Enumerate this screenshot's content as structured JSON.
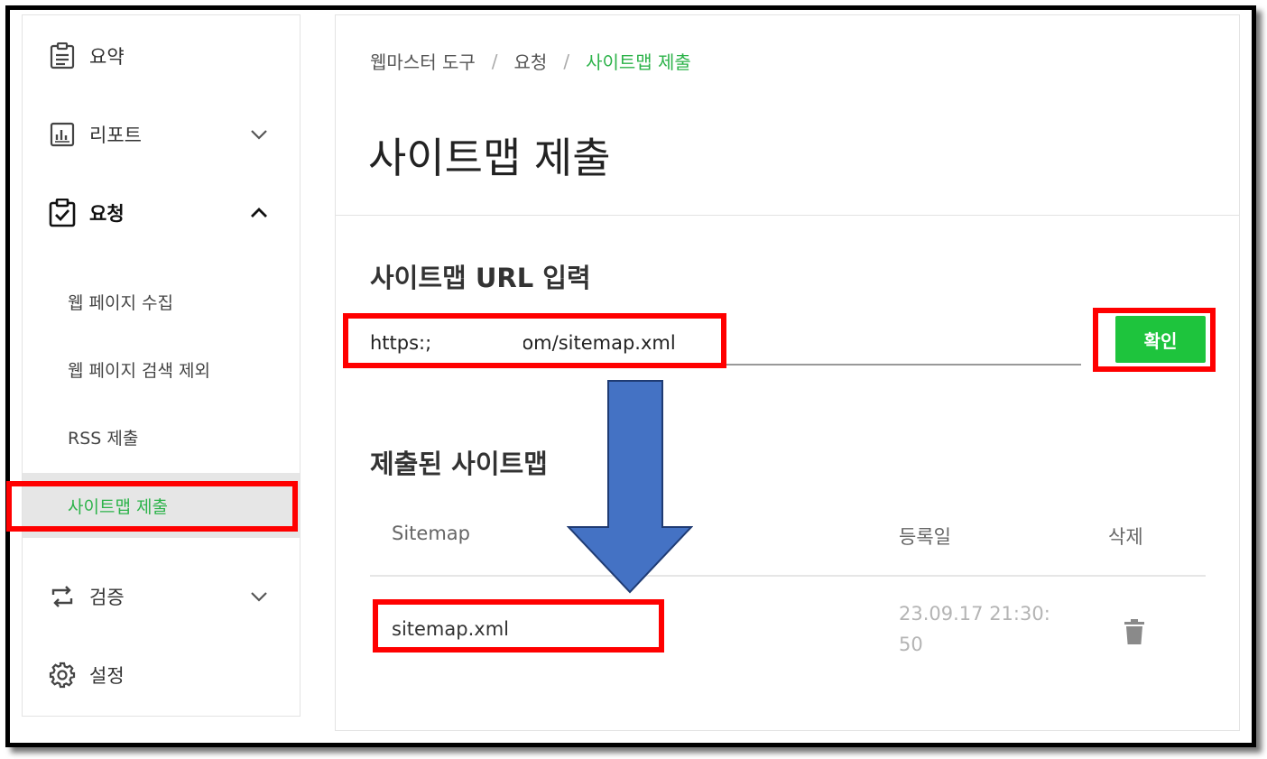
{
  "sidebar": {
    "items": [
      {
        "label": "요약",
        "icon": "clipboard-list-icon"
      },
      {
        "label": "리포트",
        "icon": "bar-chart-icon",
        "expanded": false
      },
      {
        "label": "요청",
        "icon": "clipboard-check-icon",
        "expanded": true
      },
      {
        "label": "검증",
        "icon": "repeat-arrows-icon",
        "expanded": false
      },
      {
        "label": "설정",
        "icon": "gear-icon"
      }
    ],
    "sub_items": [
      {
        "label": "웹 페이지 수집"
      },
      {
        "label": "웹 페이지 검색 제외"
      },
      {
        "label": "RSS 제출"
      },
      {
        "label": "사이트맵 제출",
        "active": true
      }
    ]
  },
  "breadcrumb": {
    "items": [
      "웹마스터 도구",
      "요청",
      "사이트맵 제출"
    ],
    "separator": "/"
  },
  "page_title": "사이트맵 제출",
  "url_section": {
    "title": "사이트맵 URL 입력",
    "input_value": "https:;               om/sitemap.xml",
    "button_label": "확인"
  },
  "submitted_section": {
    "title": "제출된 사이트맵",
    "columns": [
      "Sitemap",
      "등록일",
      "삭제"
    ],
    "rows": [
      {
        "sitemap": "sitemap.xml",
        "date_line1": "23.09.17 21:30:",
        "date_line2": "50"
      }
    ]
  },
  "colors": {
    "accent_green": "#2db34a",
    "button_green": "#1ec43d",
    "annotation_red": "#ff0000",
    "arrow_blue": "#4472c4"
  }
}
